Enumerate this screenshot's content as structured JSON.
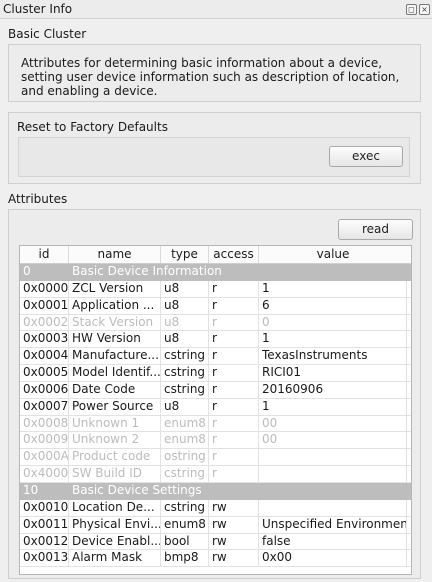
{
  "window": {
    "title": "Cluster Info"
  },
  "basic": {
    "heading": "Basic Cluster",
    "description": "Attributes for determining basic information about a device, setting user device information such as description of location, and enabling a device."
  },
  "reset": {
    "label": "Reset to Factory Defaults",
    "button": "exec"
  },
  "attributes": {
    "heading": "Attributes",
    "read_button": "read",
    "columns": [
      "id",
      "name",
      "type",
      "access",
      "value"
    ],
    "rows": [
      {
        "kind": "group",
        "id": "0",
        "name": "Basic Device Information",
        "type": "",
        "access": "",
        "value": ""
      },
      {
        "kind": "normal",
        "id": "0x0000",
        "name": "ZCL Version",
        "type": "u8",
        "access": "r",
        "value": "1"
      },
      {
        "kind": "normal",
        "id": "0x0001",
        "name": "Application ...",
        "type": "u8",
        "access": "r",
        "value": "6"
      },
      {
        "kind": "disabled",
        "id": "0x0002",
        "name": "Stack Version",
        "type": "u8",
        "access": "r",
        "value": "0"
      },
      {
        "kind": "normal",
        "id": "0x0003",
        "name": "HW Version",
        "type": "u8",
        "access": "r",
        "value": "1"
      },
      {
        "kind": "normal",
        "id": "0x0004",
        "name": "Manufacture...",
        "type": "cstring",
        "access": "r",
        "value": "TexasInstruments"
      },
      {
        "kind": "normal",
        "id": "0x0005",
        "name": "Model Identif...",
        "type": "cstring",
        "access": "r",
        "value": "RICI01"
      },
      {
        "kind": "normal",
        "id": "0x0006",
        "name": "Date Code",
        "type": "cstring",
        "access": "r",
        "value": "20160906"
      },
      {
        "kind": "normal",
        "id": "0x0007",
        "name": "Power Source",
        "type": "u8",
        "access": "r",
        "value": "1"
      },
      {
        "kind": "disabled",
        "id": "0x0008",
        "name": "Unknown 1",
        "type": "enum8",
        "access": "r",
        "value": "00"
      },
      {
        "kind": "disabled",
        "id": "0x0009",
        "name": "Unknown 2",
        "type": "enum8",
        "access": "r",
        "value": "00"
      },
      {
        "kind": "disabled",
        "id": "0x000A",
        "name": "Product code",
        "type": "ostring",
        "access": "r",
        "value": ""
      },
      {
        "kind": "disabled",
        "id": "0x4000",
        "name": "SW Build ID",
        "type": "cstring",
        "access": "r",
        "value": ""
      },
      {
        "kind": "group",
        "id": "10",
        "name": "Basic Device Settings",
        "type": "",
        "access": "",
        "value": ""
      },
      {
        "kind": "normal",
        "id": "0x0010",
        "name": "Location De...",
        "type": "cstring",
        "access": "rw",
        "value": ""
      },
      {
        "kind": "normal",
        "id": "0x0011",
        "name": "Physical Envi...",
        "type": "enum8",
        "access": "rw",
        "value": "Unspecified Environment"
      },
      {
        "kind": "normal",
        "id": "0x0012",
        "name": "Device Enabl...",
        "type": "bool",
        "access": "rw",
        "value": "false"
      },
      {
        "kind": "normal",
        "id": "0x0013",
        "name": "Alarm Mask",
        "type": "bmp8",
        "access": "rw",
        "value": "0x00"
      }
    ]
  }
}
